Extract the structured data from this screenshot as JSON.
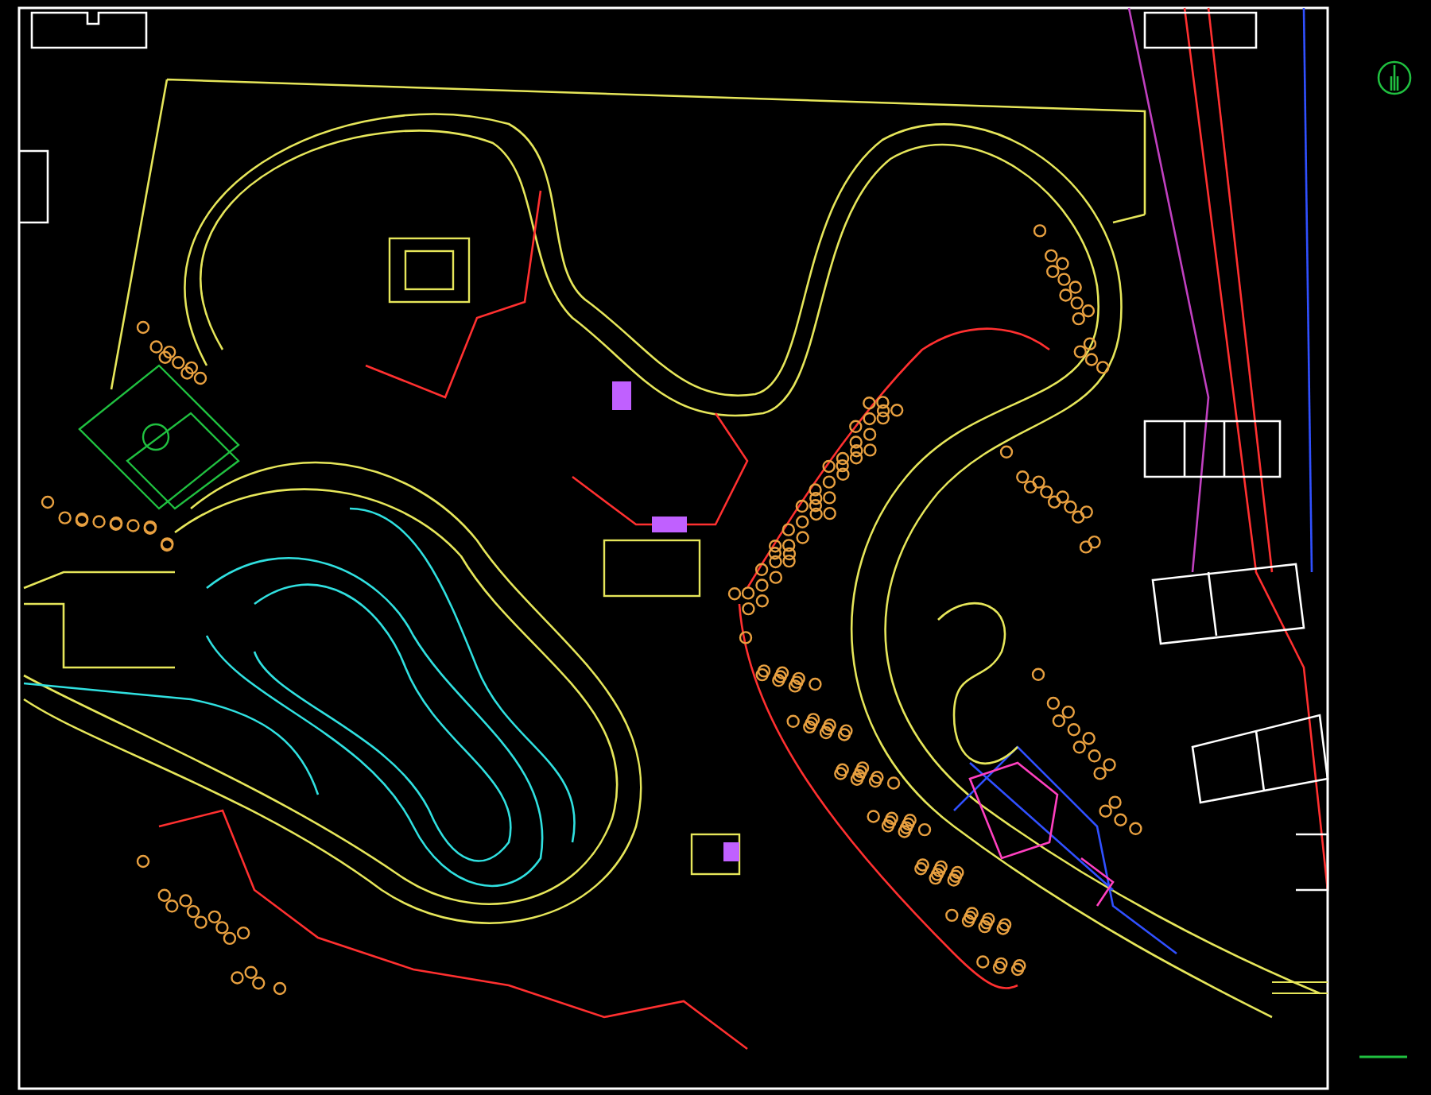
{
  "canvas": {
    "kind": "cad-site-plan"
  },
  "north_arrow": {
    "shown": true
  }
}
